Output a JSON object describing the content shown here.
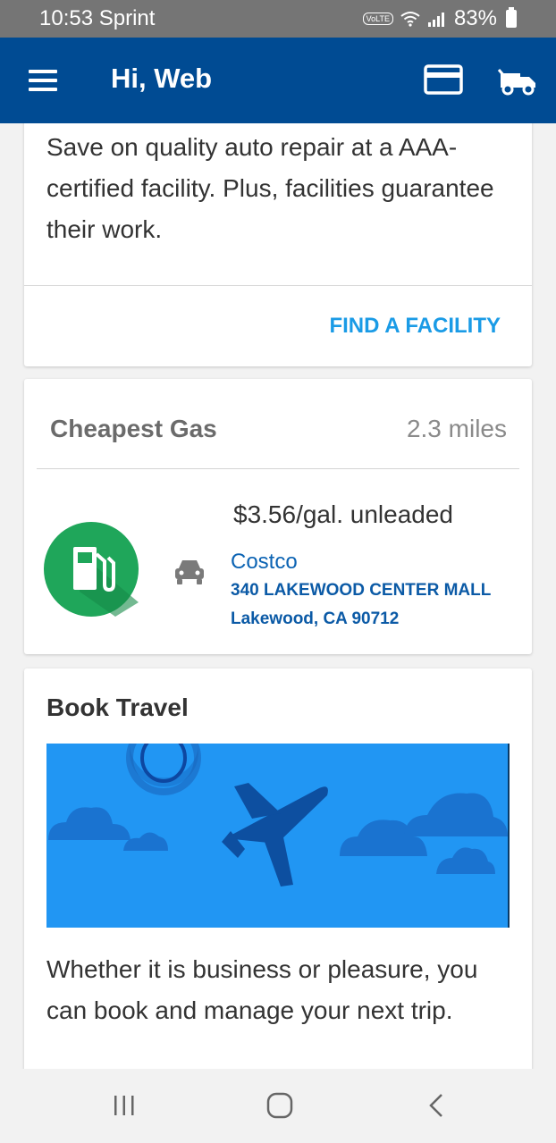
{
  "status_bar": {
    "time_carrier": "10:53 Sprint",
    "volte": "VoLTE",
    "battery": "83%"
  },
  "app_bar": {
    "title": "Hi, Web",
    "icons": [
      "menu-icon",
      "credit-card-icon",
      "tow-truck-icon"
    ],
    "background": "#004b93"
  },
  "repair_card": {
    "description": "Save on quality auto repair at a AAA-certified facility. Plus, facilities guarantee their work.",
    "action_label": "FIND A FACILITY"
  },
  "gas_card": {
    "title": "Cheapest Gas",
    "distance": "2.3 miles",
    "price": "$3.56/gal. unleaded",
    "station_name": "Costco",
    "address_line1": "340 LAKEWOOD CENTER MALL",
    "address_line2": "Lakewood, CA 90712",
    "icons": [
      "gas-pump-icon",
      "car-icon"
    ],
    "accent": "#1fa65a"
  },
  "travel_card": {
    "title": "Book Travel",
    "description": "Whether it is business or pleasure, you can book and manage your next trip.",
    "banner_icons": [
      "sun-icon",
      "airplane-icon",
      "cloud-icon"
    ],
    "banner_color": "#2196f3"
  },
  "nav_bar": {
    "icons": [
      "recent-apps-icon",
      "home-icon",
      "back-icon"
    ]
  }
}
